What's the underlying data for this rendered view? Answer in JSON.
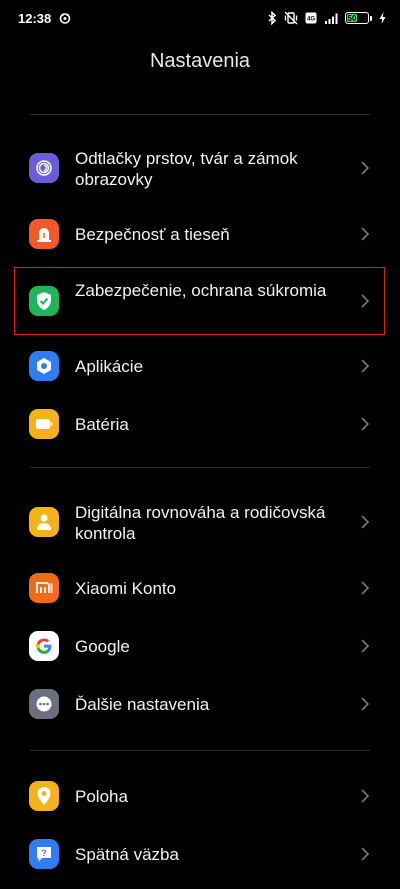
{
  "status": {
    "time": "12:38",
    "battery_level": "50"
  },
  "title": "Nastavenia",
  "groups": [
    {
      "items": [
        {
          "label": "Odtlačky prstov, tvár a zámok obrazovky",
          "icon": "fingerprint-icon",
          "color": "#6b5bd6"
        },
        {
          "label": "Bezpečnosť a tieseň",
          "icon": "emergency-icon",
          "color": "#f05a28"
        },
        {
          "label": "Zabezpečenie, ochrana súkromia",
          "icon": "shield-check-icon",
          "color": "#1fb55a"
        },
        {
          "label": "Aplikácie",
          "icon": "apps-hexagon-icon",
          "color": "#2f7df0"
        },
        {
          "label": "Batéria",
          "icon": "battery-icon",
          "color": "#f5b21a"
        }
      ]
    },
    {
      "items": [
        {
          "label": "Digitálna rovnováha a rodičovská kontrola",
          "icon": "digital-wellbeing-icon",
          "color": "#f5b21a"
        },
        {
          "label": "Xiaomi Konto",
          "icon": "mi-logo-icon",
          "color": "#f26b1d"
        },
        {
          "label": "Google",
          "icon": "google-g-icon",
          "color": "#ffffff"
        },
        {
          "label": "Ďalšie nastavenia",
          "icon": "more-dots-icon",
          "color": "#6c6f80"
        }
      ]
    },
    {
      "items": [
        {
          "label": "Poloha",
          "icon": "location-pin-icon",
          "color": "#f5b21a"
        },
        {
          "label": "Spätná väzba",
          "icon": "feedback-icon",
          "color": "#2f7df0"
        }
      ]
    }
  ],
  "highlight_color": "#e01e1e"
}
